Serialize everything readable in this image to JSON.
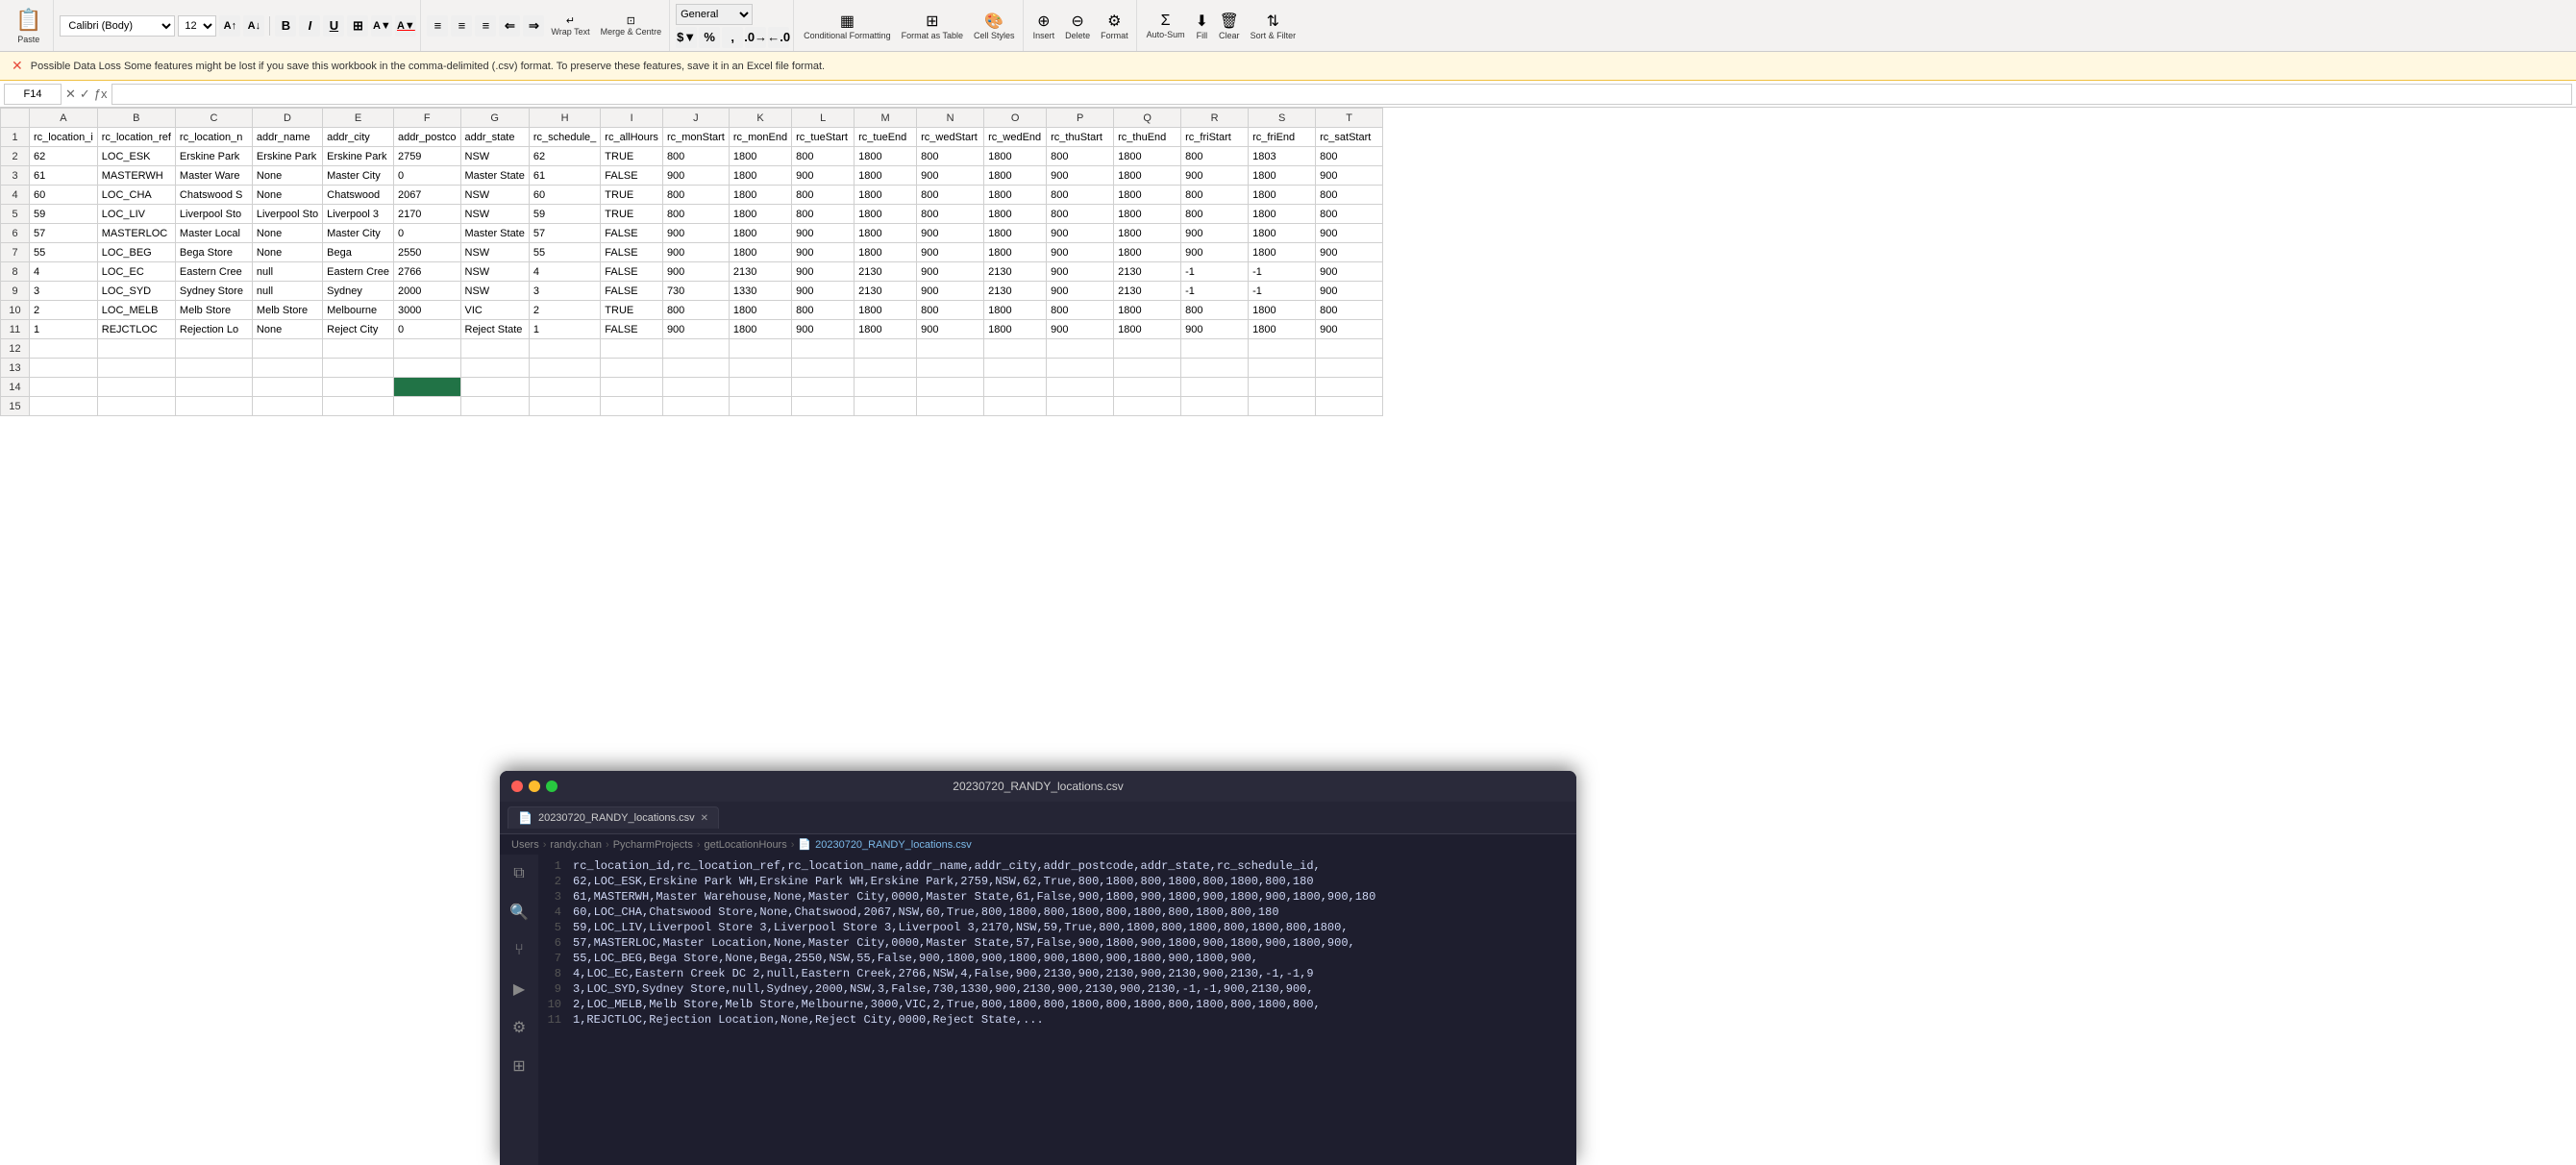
{
  "app": {
    "title": "20230720_RANDY_locations.csv"
  },
  "ribbon": {
    "font_name": "Calibri (Body)",
    "font_size": "12",
    "paste_label": "Paste",
    "bold": "B",
    "italic": "I",
    "underline": "U",
    "wrap_text": "Wrap Text",
    "merge_centre": "Merge & Centre",
    "number_format": "General",
    "conditional_formatting": "Conditional Formatting",
    "format_as_table": "Format as Table",
    "cell_styles": "Cell Styles",
    "insert": "Insert",
    "delete": "Delete",
    "format": "Format",
    "clear": "Clear",
    "sort_filter": "Sort & Filter",
    "auto_sum": "Auto-Sum",
    "fill": "Fill"
  },
  "formula_bar": {
    "cell_ref": "F14",
    "formula": ""
  },
  "warning": {
    "text": "Possible Data Loss  Some features might be lost if you save this workbook in the comma-delimited (.csv) format. To preserve these features, save it in an Excel file format."
  },
  "columns": [
    "",
    "A",
    "B",
    "C",
    "D",
    "E",
    "F",
    "G",
    "H",
    "I",
    "J",
    "K",
    "L",
    "M",
    "N",
    "O",
    "P",
    "Q",
    "R",
    "S",
    "T"
  ],
  "col_headers": {
    "A": "rc_location_i",
    "B": "rc_location_ref",
    "C": "rc_location_n",
    "D": "addr_name",
    "E": "addr_city",
    "F": "addr_postco",
    "G": "addr_state",
    "H": "rc_schedule_",
    "I": "rc_allHours",
    "J": "rc_monStart",
    "K": "rc_monEnd",
    "L": "rc_tueStart",
    "M": "rc_tueEnd",
    "N": "rc_wedStart",
    "O": "rc_wedEnd",
    "P": "rc_thuStart",
    "Q": "rc_thuEnd",
    "R": "rc_friStart",
    "S": "rc_friEnd",
    "T": "rc_satStart"
  },
  "rows": [
    {
      "row": 1,
      "A": "",
      "B": "",
      "C": "",
      "D": "",
      "E": "",
      "F": "",
      "G": "",
      "H": "",
      "I": "",
      "J": "",
      "K": "",
      "L": "",
      "M": "",
      "N": "",
      "O": "",
      "P": "",
      "Q": "",
      "R": "",
      "S": "",
      "T": "",
      "header": true
    },
    {
      "row": 2,
      "A": "62",
      "B": "LOC_ESK",
      "C": "Erskine Park",
      "D": "Erskine Park",
      "E": "Erskine Park",
      "F": "2759",
      "G": "NSW",
      "H": "62",
      "I": "TRUE",
      "J": "800",
      "K": "1800",
      "L": "800",
      "M": "1800",
      "N": "800",
      "O": "1800",
      "P": "800",
      "Q": "1800",
      "R": "800",
      "S": "1803",
      "T": "800"
    },
    {
      "row": 3,
      "A": "61",
      "B": "MASTERWH",
      "C": "Master Ware",
      "D": "None",
      "E": "Master City",
      "F": "0",
      "G": "Master State",
      "H": "61",
      "I": "FALSE",
      "J": "900",
      "K": "1800",
      "L": "900",
      "M": "1800",
      "N": "900",
      "O": "1800",
      "P": "900",
      "Q": "1800",
      "R": "900",
      "S": "1800",
      "T": "900"
    },
    {
      "row": 4,
      "A": "60",
      "B": "LOC_CHA",
      "C": "Chatswood S",
      "D": "None",
      "E": "Chatswood",
      "F": "2067",
      "G": "NSW",
      "H": "60",
      "I": "TRUE",
      "J": "800",
      "K": "1800",
      "L": "800",
      "M": "1800",
      "N": "800",
      "O": "1800",
      "P": "800",
      "Q": "1800",
      "R": "800",
      "S": "1800",
      "T": "800"
    },
    {
      "row": 5,
      "A": "59",
      "B": "LOC_LIV",
      "C": "Liverpool Sto",
      "D": "Liverpool Sto",
      "E": "Liverpool 3",
      "F": "2170",
      "G": "NSW",
      "H": "59",
      "I": "TRUE",
      "J": "800",
      "K": "1800",
      "L": "800",
      "M": "1800",
      "N": "800",
      "O": "1800",
      "P": "800",
      "Q": "1800",
      "R": "800",
      "S": "1800",
      "T": "800"
    },
    {
      "row": 6,
      "A": "57",
      "B": "MASTERLOC",
      "C": "Master Local",
      "D": "None",
      "E": "Master City",
      "F": "0",
      "G": "Master State",
      "H": "57",
      "I": "FALSE",
      "J": "900",
      "K": "1800",
      "L": "900",
      "M": "1800",
      "N": "900",
      "O": "1800",
      "P": "900",
      "Q": "1800",
      "R": "900",
      "S": "1800",
      "T": "900"
    },
    {
      "row": 7,
      "A": "55",
      "B": "LOC_BEG",
      "C": "Bega Store",
      "D": "None",
      "E": "Bega",
      "F": "2550",
      "G": "NSW",
      "H": "55",
      "I": "FALSE",
      "J": "900",
      "K": "1800",
      "L": "900",
      "M": "1800",
      "N": "900",
      "O": "1800",
      "P": "900",
      "Q": "1800",
      "R": "900",
      "S": "1800",
      "T": "900"
    },
    {
      "row": 8,
      "A": "4",
      "B": "LOC_EC",
      "C": "Eastern Cree",
      "D": "null",
      "E": "Eastern Cree",
      "F": "2766",
      "G": "NSW",
      "H": "4",
      "I": "FALSE",
      "J": "900",
      "K": "2130",
      "L": "900",
      "M": "2130",
      "N": "900",
      "O": "2130",
      "P": "900",
      "Q": "2130",
      "R": "-1",
      "S": "-1",
      "T": "900"
    },
    {
      "row": 9,
      "A": "3",
      "B": "LOC_SYD",
      "C": "Sydney Store",
      "D": "null",
      "E": "Sydney",
      "F": "2000",
      "G": "NSW",
      "H": "3",
      "I": "FALSE",
      "J": "730",
      "K": "1330",
      "L": "900",
      "M": "2130",
      "N": "900",
      "O": "2130",
      "P": "900",
      "Q": "2130",
      "R": "-1",
      "S": "-1",
      "T": "900"
    },
    {
      "row": 10,
      "A": "2",
      "B": "LOC_MELB",
      "C": "Melb Store",
      "D": "Melb Store",
      "E": "Melbourne",
      "F": "3000",
      "G": "VIC",
      "H": "2",
      "I": "TRUE",
      "J": "800",
      "K": "1800",
      "L": "800",
      "M": "1800",
      "N": "800",
      "O": "1800",
      "P": "800",
      "Q": "1800",
      "R": "800",
      "S": "1800",
      "T": "800"
    },
    {
      "row": 11,
      "A": "1",
      "B": "REJCTLOC",
      "C": "Rejection Lo",
      "D": "None",
      "E": "Reject City",
      "F": "0",
      "G": "Reject State",
      "H": "1",
      "I": "FALSE",
      "J": "900",
      "K": "1800",
      "L": "900",
      "M": "1800",
      "N": "900",
      "O": "1800",
      "P": "900",
      "Q": "1800",
      "R": "900",
      "S": "1800",
      "T": "900"
    },
    {
      "row": 12,
      "A": "",
      "B": "",
      "C": "",
      "D": "",
      "E": "",
      "F": "",
      "G": "",
      "H": "",
      "I": "",
      "J": "",
      "K": "",
      "L": "",
      "M": "",
      "N": "",
      "O": "",
      "P": "",
      "Q": "",
      "R": "",
      "S": "",
      "T": ""
    },
    {
      "row": 13,
      "A": "",
      "B": "",
      "C": "",
      "D": "",
      "E": "",
      "F": "",
      "G": "",
      "H": "",
      "I": "",
      "J": "",
      "K": "",
      "L": "",
      "M": "",
      "N": "",
      "O": "",
      "P": "",
      "Q": "",
      "R": "",
      "S": "",
      "T": ""
    },
    {
      "row": 14,
      "A": "",
      "B": "",
      "C": "",
      "D": "",
      "E": "",
      "F": "",
      "G": "",
      "H": "",
      "I": "",
      "J": "",
      "K": "",
      "L": "",
      "M": "",
      "N": "",
      "O": "",
      "P": "",
      "Q": "",
      "R": "",
      "S": "",
      "T": "",
      "selected": true
    },
    {
      "row": 15,
      "A": "",
      "B": "",
      "C": "",
      "D": "",
      "E": "",
      "F": "",
      "G": "",
      "H": "",
      "I": "",
      "J": "",
      "K": "",
      "L": "",
      "M": "",
      "N": "",
      "O": "",
      "P": "",
      "Q": "",
      "R": "",
      "S": "",
      "T": ""
    }
  ],
  "csv_viewer": {
    "title": "20230720_RANDY_locations.csv",
    "tab_label": "20230720_RANDY_locations.csv",
    "breadcrumb": [
      "Users",
      "randy.chan",
      "PycharmProjects",
      "getLocationHours",
      "20230720_RANDY_locations.csv"
    ],
    "lines": [
      {
        "num": 1,
        "content": "rc_location_id,rc_location_ref,rc_location_name,addr_name,addr_city,addr_postcode,addr_state,rc_schedule_id,"
      },
      {
        "num": 2,
        "content": "62,LOC_ESK,Erskine Park WH,Erskine Park WH,Erskine Park,2759,NSW,62,True,800,1800,800,1800,800,1800,800,180"
      },
      {
        "num": 3,
        "content": "61,MASTERWH,Master Warehouse,None,Master City,0000,Master State,61,False,900,1800,900,1800,900,1800,900,1800,900,180"
      },
      {
        "num": 4,
        "content": "60,LOC_CHA,Chatswood Store,None,Chatswood,2067,NSW,60,True,800,1800,800,1800,800,1800,800,1800,800,180"
      },
      {
        "num": 5,
        "content": "59,LOC_LIV,Liverpool Store 3,Liverpool Store 3,Liverpool 3,2170,NSW,59,True,800,1800,800,1800,800,1800,800,1800,"
      },
      {
        "num": 6,
        "content": "57,MASTERLOC,Master Location,None,Master City,0000,Master State,57,False,900,1800,900,1800,900,1800,900,1800,900,"
      },
      {
        "num": 7,
        "content": "55,LOC_BEG,Bega Store,None,Bega,2550,NSW,55,False,900,1800,900,1800,900,1800,900,1800,900,1800,900,"
      },
      {
        "num": 8,
        "content": "4,LOC_EC,Eastern Creek DC 2,null,Eastern Creek,2766,NSW,4,False,900,2130,900,2130,900,2130,900,2130,-1,-1,9"
      },
      {
        "num": 9,
        "content": "3,LOC_SYD,Sydney Store,null,Sydney,2000,NSW,3,False,730,1330,900,2130,900,2130,900,2130,-1,-1,900,2130,900,"
      },
      {
        "num": 10,
        "content": "2,LOC_MELB,Melb Store,Melb Store,Melbourne,3000,VIC,2,True,800,1800,800,1800,800,1800,800,1800,800,1800,800,"
      },
      {
        "num": 11,
        "content": "1,REJCTLOC,Rejection Location,None,Reject City,0000,Reject State,..."
      }
    ]
  }
}
